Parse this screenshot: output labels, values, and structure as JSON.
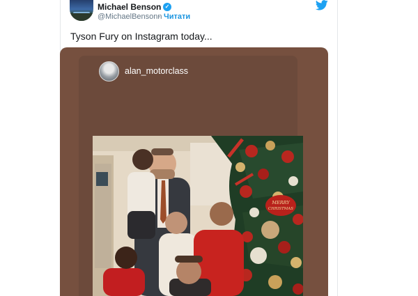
{
  "tweet": {
    "author_name": "Michael Benson",
    "verified_mark": "✓",
    "author_handle": "@MichaelBensonn",
    "separator": "·",
    "follow_label": "Читати",
    "text": "Tyson Fury on Instagram today...",
    "icons": {
      "verified": "verified-badge-icon",
      "platform": "twitter-bird-icon"
    },
    "colors": {
      "accent": "#1da1f2",
      "link": "#1b95e0",
      "story_bg": "#76503f"
    }
  },
  "embedded_story": {
    "username": "alan_motorclass",
    "ornament_text": "MERRY CHRISTMAS"
  }
}
